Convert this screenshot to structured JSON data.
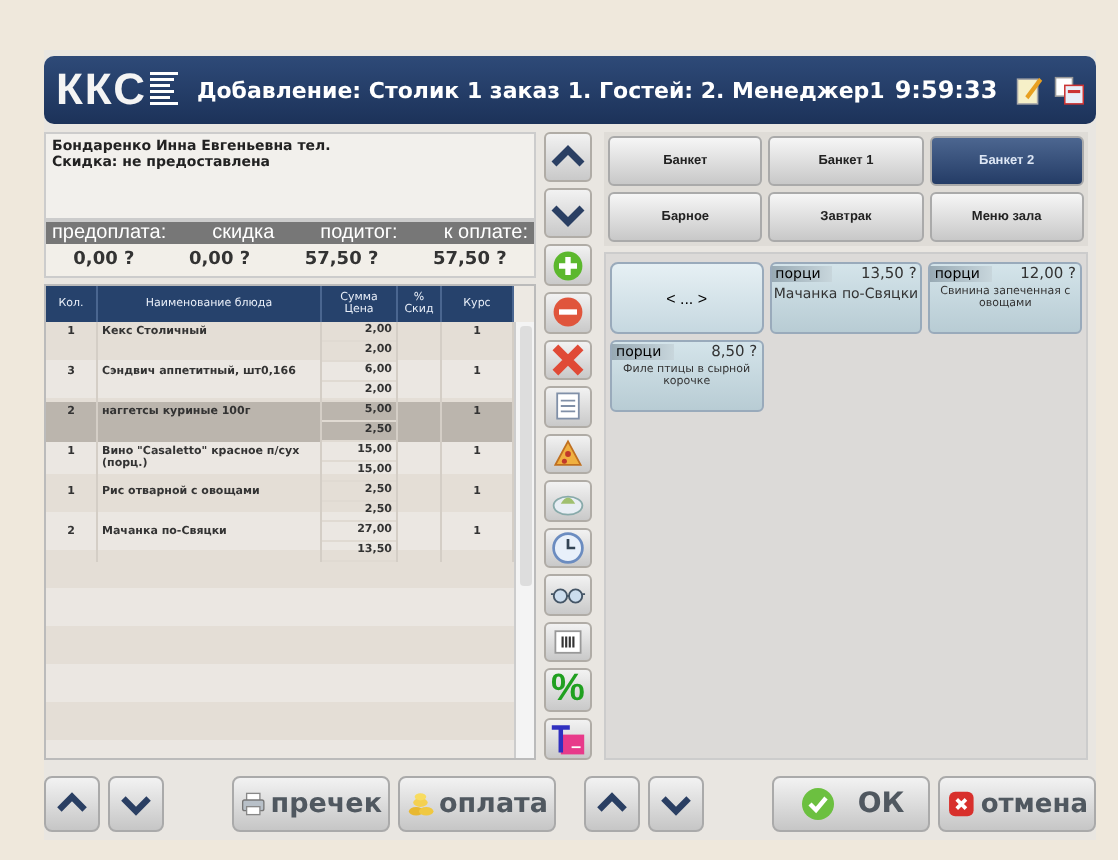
{
  "header": {
    "logo": "ККС",
    "title": "Добавление: Столик 1 заказ 1. Гостей: 2. Менеджер1",
    "time": "9:59:33"
  },
  "customer": {
    "lines": [
      "Бондаренко Инна Евгеньевна тел.",
      "Скидка: не предоставлена"
    ]
  },
  "summary": [
    {
      "label": "предоплата:",
      "value": "0,00 ?"
    },
    {
      "label": "скидка",
      "value": "0,00 ?"
    },
    {
      "label": "подитог:",
      "value": "57,50 ?"
    },
    {
      "label": "к оплате:",
      "value": "57,50 ?"
    }
  ],
  "table": {
    "columns": [
      {
        "label": "Кол."
      },
      {
        "label": "Наименование блюда"
      },
      {
        "label": "Сумма",
        "sublabel": "Цена"
      },
      {
        "label": "%",
        "sublabel": "Скид"
      },
      {
        "label": "Курс"
      }
    ],
    "rows": [
      {
        "qty": "1",
        "name": "Кекс Столичный",
        "sum": "2,00",
        "price": "2,00",
        "course": "1",
        "selected": false
      },
      {
        "qty": "3",
        "name": "Сэндвич аппетитный, шт0,166",
        "sum": "6,00",
        "price": "2,00",
        "course": "1",
        "selected": false
      },
      {
        "qty": "2",
        "name": "наггетсы куриные 100г",
        "sum": "5,00",
        "price": "2,50",
        "course": "1",
        "selected": true
      },
      {
        "qty": "1",
        "name": "Вино \"Casaletto\" красное п/сух (порц.)",
        "sum": "15,00",
        "price": "15,00",
        "course": "1",
        "selected": false
      },
      {
        "qty": "1",
        "name": "Рис отварной с овощами",
        "sum": "2,50",
        "price": "2,50",
        "course": "1",
        "selected": false
      },
      {
        "qty": "2",
        "name": "Мачанка по-Свяцки",
        "sum": "27,00",
        "price": "13,50",
        "course": "1",
        "selected": false
      }
    ]
  },
  "toolbar": [
    {
      "kind": "up"
    },
    {
      "kind": "down"
    },
    {
      "kind": "add"
    },
    {
      "kind": "remove"
    },
    {
      "kind": "delete"
    },
    {
      "kind": "document"
    },
    {
      "kind": "pizza"
    },
    {
      "kind": "dish"
    },
    {
      "kind": "clock"
    },
    {
      "kind": "glasses"
    },
    {
      "kind": "barcode"
    },
    {
      "kind": "text",
      "label": "%"
    },
    {
      "kind": "split"
    }
  ],
  "menu_tabs": [
    {
      "label": "Банкет",
      "selected": false
    },
    {
      "label": "Банкет 1",
      "selected": false
    },
    {
      "label": "Банкет 2",
      "selected": true
    },
    {
      "label": "Барное",
      "selected": false
    },
    {
      "label": "Завтрак",
      "selected": false
    },
    {
      "label": "Меню зала",
      "selected": false
    }
  ],
  "items": [
    {
      "kind": "nav",
      "label": "< ... >"
    },
    {
      "kind": "dish",
      "unit": "порци",
      "price": "13,50 ?",
      "name": "Мачанка по-Свяцки"
    },
    {
      "kind": "dish",
      "unit": "порци",
      "price": "12,00 ?",
      "name": "Свинина запеченная с овощами"
    },
    {
      "kind": "dish",
      "unit": "порци",
      "price": "8,50 ?",
      "name": "Филе птицы в сырной корочке"
    }
  ],
  "bottom_left": [
    {
      "kind": "up"
    },
    {
      "kind": "down"
    },
    {
      "kind": "precheck",
      "label": "пречек"
    },
    {
      "kind": "payment",
      "label": "оплата"
    }
  ],
  "bottom_right": [
    {
      "kind": "up"
    },
    {
      "kind": "down"
    },
    {
      "kind": "ok",
      "label": "ОК"
    },
    {
      "kind": "cancel",
      "label": "отмена"
    }
  ]
}
